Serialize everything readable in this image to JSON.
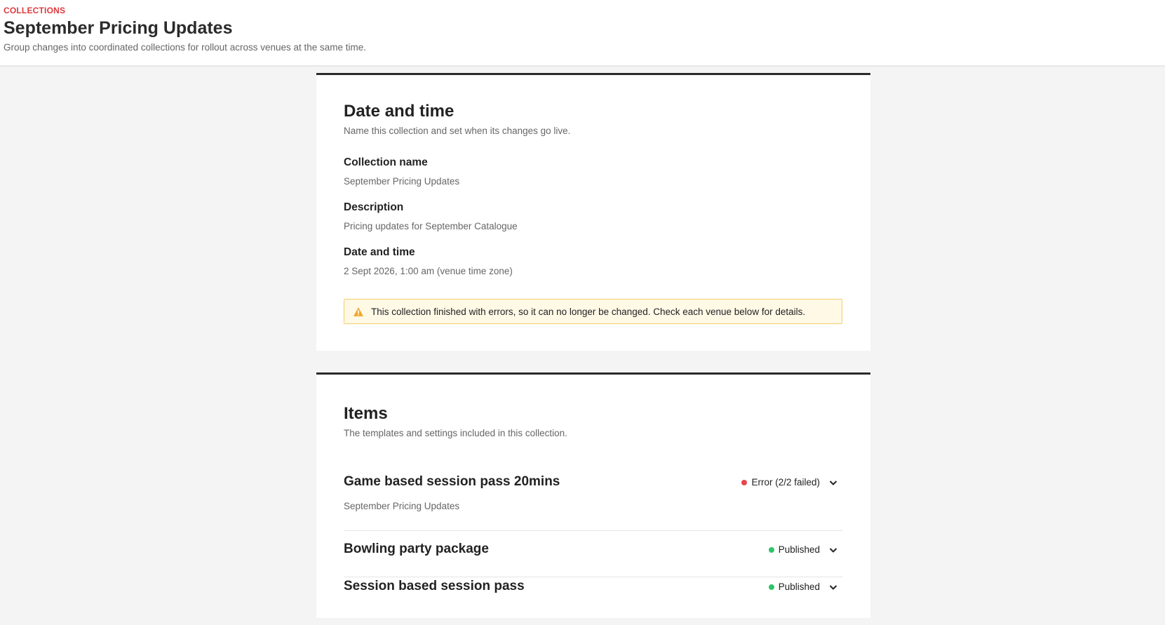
{
  "header": {
    "eyebrow": "COLLECTIONS",
    "title": "September Pricing Updates",
    "subtitle": "Group changes into coordinated collections for rollout across venues at the same time."
  },
  "date_section": {
    "title": "Date and time",
    "description": "Name this collection and set when its changes go live.",
    "fields": [
      {
        "label": "Collection name",
        "value": "September Pricing Updates"
      },
      {
        "label": "Description",
        "value": "Pricing updates for September Catalogue"
      },
      {
        "label": "Date and time",
        "value": "2 Sept 2026, 1:00 am (venue time zone)"
      }
    ],
    "alert": {
      "icon": "warning-icon",
      "text": "This collection finished with errors, so it can no longer be changed. Check each venue below for details."
    }
  },
  "items_section": {
    "title": "Items",
    "description": "The templates and settings included in this collection.",
    "items": [
      {
        "name": "Game based session pass 20mins",
        "subtitle": "September Pricing Updates",
        "status": "Error (2/2 failed)",
        "status_color": "#e5484d"
      },
      {
        "name": "Bowling party package",
        "subtitle": "",
        "status": "Published",
        "status_color": "#30c46a"
      },
      {
        "name": "Session based session pass",
        "subtitle": "",
        "status": "Published",
        "status_color": "#30c46a"
      }
    ]
  },
  "colors": {
    "accent_red": "#e0393e",
    "warning_bg": "#fff9e6",
    "warning_border": "#f3cd6b",
    "warning_icon": "#f0a92a"
  }
}
